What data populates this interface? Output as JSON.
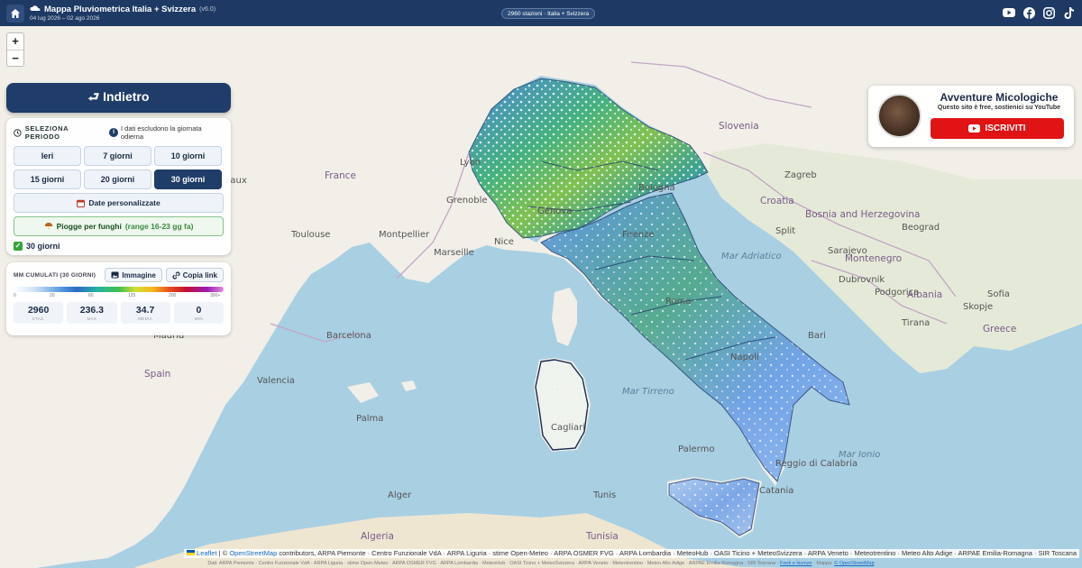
{
  "header": {
    "title": "Mappa Pluviometrica Italia + Svizzera",
    "version": "(v6.0)",
    "subtitle": "04 lug 2026 – 02 ago 2026",
    "stations_badge": "2960 stazioni · Italia + Svizzera",
    "social_icons": [
      "youtube-icon",
      "facebook-icon",
      "instagram-icon",
      "tiktok-icon"
    ]
  },
  "zoom": {
    "in": "+",
    "out": "−"
  },
  "back_button": {
    "label": "⮐ Indietro"
  },
  "period": {
    "title": "SELEZIONA PERIODO",
    "note": "I dati escludono la giornata odierna",
    "options": [
      "Ieri",
      "7 giorni",
      "10 giorni",
      "15 giorni",
      "20 giorni",
      "30 giorni"
    ],
    "active": "30 giorni",
    "custom_label": "Date personalizzate",
    "fungi_label": "Piogge per funghi",
    "fungi_range": "(range 16-23 gg fa)",
    "selected_label": "30 giorni"
  },
  "legend": {
    "title": "MM CUMULATI (30 GIORNI)",
    "image_button": "Immagine",
    "link_button": "Copia link",
    "ticks": [
      "0",
      "20",
      "60",
      "125",
      "200",
      "300+"
    ],
    "stats": [
      {
        "value": "2960",
        "key": "STAZ."
      },
      {
        "value": "236.3",
        "key": "MAX"
      },
      {
        "value": "34.7",
        "key": "MEDIA"
      },
      {
        "value": "0",
        "key": "MIN"
      }
    ]
  },
  "youtube": {
    "name": "Avventure Micologiche",
    "tagline": "Questo sito è free, sostienici su YouTube",
    "button": "ISCRIVITI"
  },
  "map_labels": {
    "countries": [
      "Slovenia",
      "Croatia",
      "Bosnia and Herzegovina",
      "Montenegro",
      "Albania",
      "Greece",
      "Tunisia",
      "Algeria",
      "Spain",
      "France"
    ],
    "cities": [
      "Genova",
      "Marseille",
      "Toulouse",
      "Bordeaux",
      "Barcelona",
      "Valencia",
      "Madrid",
      "Palermo",
      "Cagliari",
      "Bologna",
      "Napoli",
      "Roma",
      "Firenze",
      "Tunis",
      "Alger",
      "Zagreb",
      "Sarajevo",
      "Beograd",
      "Podgorica",
      "Tirana",
      "Skopje",
      "Sofia",
      "Lyon",
      "Grenoble",
      "Montpellier",
      "Nice",
      "Palma",
      "Split",
      "Dubrovnik",
      "Bari",
      "Reggio di Calabria",
      "Catania"
    ],
    "seas": [
      "Mar Tirreno",
      "Mar Ionio",
      "Mar Adriatico"
    ]
  },
  "attribution": {
    "leaflet": "Leaflet",
    "osm": "OpenStreetMap",
    "sources": "contributors, ARPA Piemonte · Centro Funzionale VdA · ARPA Liguria · stime Open-Meteo · ARPA OSMER FVG · ARPA Lombardia · MeteoHub · OASI Ticino + MeteoSvizzera · ARPA Veneto · Meteotrentino · Meteo Alto Adige · ARPAE Emilia-Romagna · SIR Toscana"
  },
  "credits": {
    "text": "Dati: ARPA Piemonte · Centro Funzionale VdA · ARPA Liguria · stime Open-Meteo · ARPA OSMER FVG · ARPA Lombardia · MeteoHub · OASI Ticino + MeteoSvizzera · ARPA Veneto · Meteotrentino · Meteo Alto Adige · ARPAE Emilia-Romagna · SIR Toscana ·",
    "link": "Fonti e licenze",
    "map": "· Mappa:",
    "map_link": "© OpenStreetMap"
  },
  "colors": {
    "header_bg": "#1e3a64",
    "active_button": "#1f3d68",
    "youtube_red": "#e01414",
    "fungi_green": "#3b8a3f",
    "sea": "#a9cfe3",
    "land": "#f1efe8"
  }
}
